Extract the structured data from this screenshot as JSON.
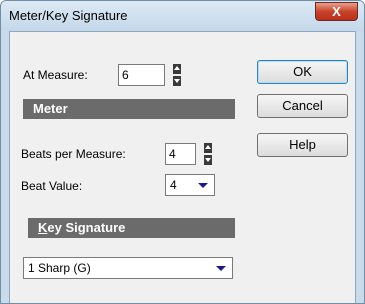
{
  "window": {
    "title": "Meter/Key Signature",
    "close_symbol": "X"
  },
  "at_measure": {
    "label": "At Measure:",
    "value": "6"
  },
  "meter": {
    "section_label": "Meter",
    "beats_label": "Beats per Measure:",
    "beats_value": "4",
    "beat_value_label": "Beat Value:",
    "beat_value_selected": "4"
  },
  "key_signature": {
    "section_label_accel": "K",
    "section_label_rest": "ey Signature",
    "selected": "1 Sharp (G)"
  },
  "buttons": {
    "ok": "OK",
    "cancel": "Cancel",
    "help": "Help"
  }
}
